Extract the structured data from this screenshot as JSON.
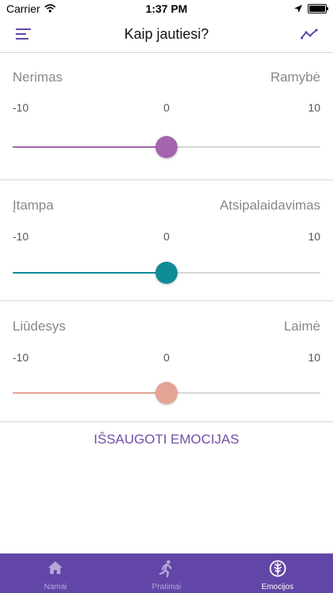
{
  "status_bar": {
    "carrier": "Carrier",
    "time": "1:37 PM"
  },
  "header": {
    "title": "Kaip jautiesi?",
    "menu_icon": "menu-icon",
    "chart_icon": "trend-icon"
  },
  "sliders": [
    {
      "left_label": "Nerimas",
      "right_label": "Ramybė",
      "min": "-10",
      "mid": "0",
      "max": "10",
      "value": 0,
      "color": "#a564ae"
    },
    {
      "left_label": "Įtampa",
      "right_label": "Atsipalaidavimas",
      "min": "-10",
      "mid": "0",
      "max": "10",
      "value": 0,
      "color": "#0f8c95"
    },
    {
      "left_label": "Liūdesys",
      "right_label": "Laimė",
      "min": "-10",
      "mid": "0",
      "max": "10",
      "value": 0,
      "color": "#e3a395"
    }
  ],
  "save_label": "IŠSAUGOTI EMOCIJAS",
  "tabs": [
    {
      "label": "Namai",
      "icon": "home-icon",
      "active": false
    },
    {
      "label": "Pratimai",
      "icon": "running-icon",
      "active": false
    },
    {
      "label": "Emocijos",
      "icon": "emotions-icon",
      "active": true
    }
  ],
  "colors": {
    "accent": "#6246a7",
    "link": "#6f4ea8"
  }
}
